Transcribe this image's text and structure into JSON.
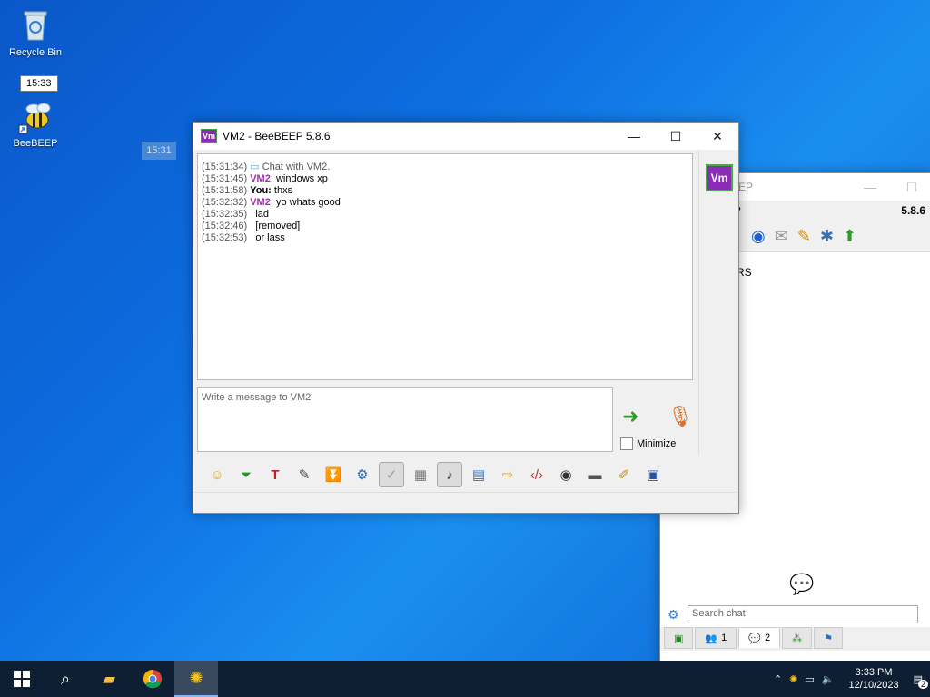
{
  "desktop": {
    "icons": [
      {
        "label": "Recycle Bin"
      },
      {
        "label": "BeeBEEP"
      }
    ],
    "tooltip": "15:33",
    "drag_ghost": "15:31"
  },
  "chat_window": {
    "title": "VM2 - BeeBEEP 5.8.6",
    "app_badge": "Vm",
    "log": [
      {
        "time": "(15:31:34)",
        "sender": "",
        "text": "Chat with VM2."
      },
      {
        "time": "(15:31:45)",
        "sender": "VM2",
        "text": ": windows xp"
      },
      {
        "time": "(15:31:58)",
        "sender": "You:",
        "text": " thxs"
      },
      {
        "time": "(15:32:32)",
        "sender": "VM2",
        "text": ": yo whats good"
      },
      {
        "time": "(15:32:35)",
        "sender": "",
        "text": "lad"
      },
      {
        "time": "(15:32:46)",
        "sender": "",
        "text": "[removed]"
      },
      {
        "time": "(15:32:53)",
        "sender": "",
        "text": "or lass"
      }
    ],
    "message_placeholder": "Write a message to VM2",
    "minimize_label": "Minimize",
    "avatar": "Vm"
  },
  "back_window": {
    "title": "BEEP",
    "menu_items": [
      "s",
      "?"
    ],
    "version": "5.8.6",
    "partial_text": "RS",
    "search_placeholder": "Search chat",
    "tabs": [
      {
        "icon": "chat-green-icon",
        "label": ""
      },
      {
        "icon": "users-icon",
        "label": "1"
      },
      {
        "icon": "chats-icon",
        "label": "2"
      },
      {
        "icon": "groups-icon",
        "label": ""
      },
      {
        "icon": "files-icon",
        "label": ""
      }
    ]
  },
  "taskbar": {
    "time": "3:33 PM",
    "date": "12/10/2023",
    "notification_count": "2"
  }
}
